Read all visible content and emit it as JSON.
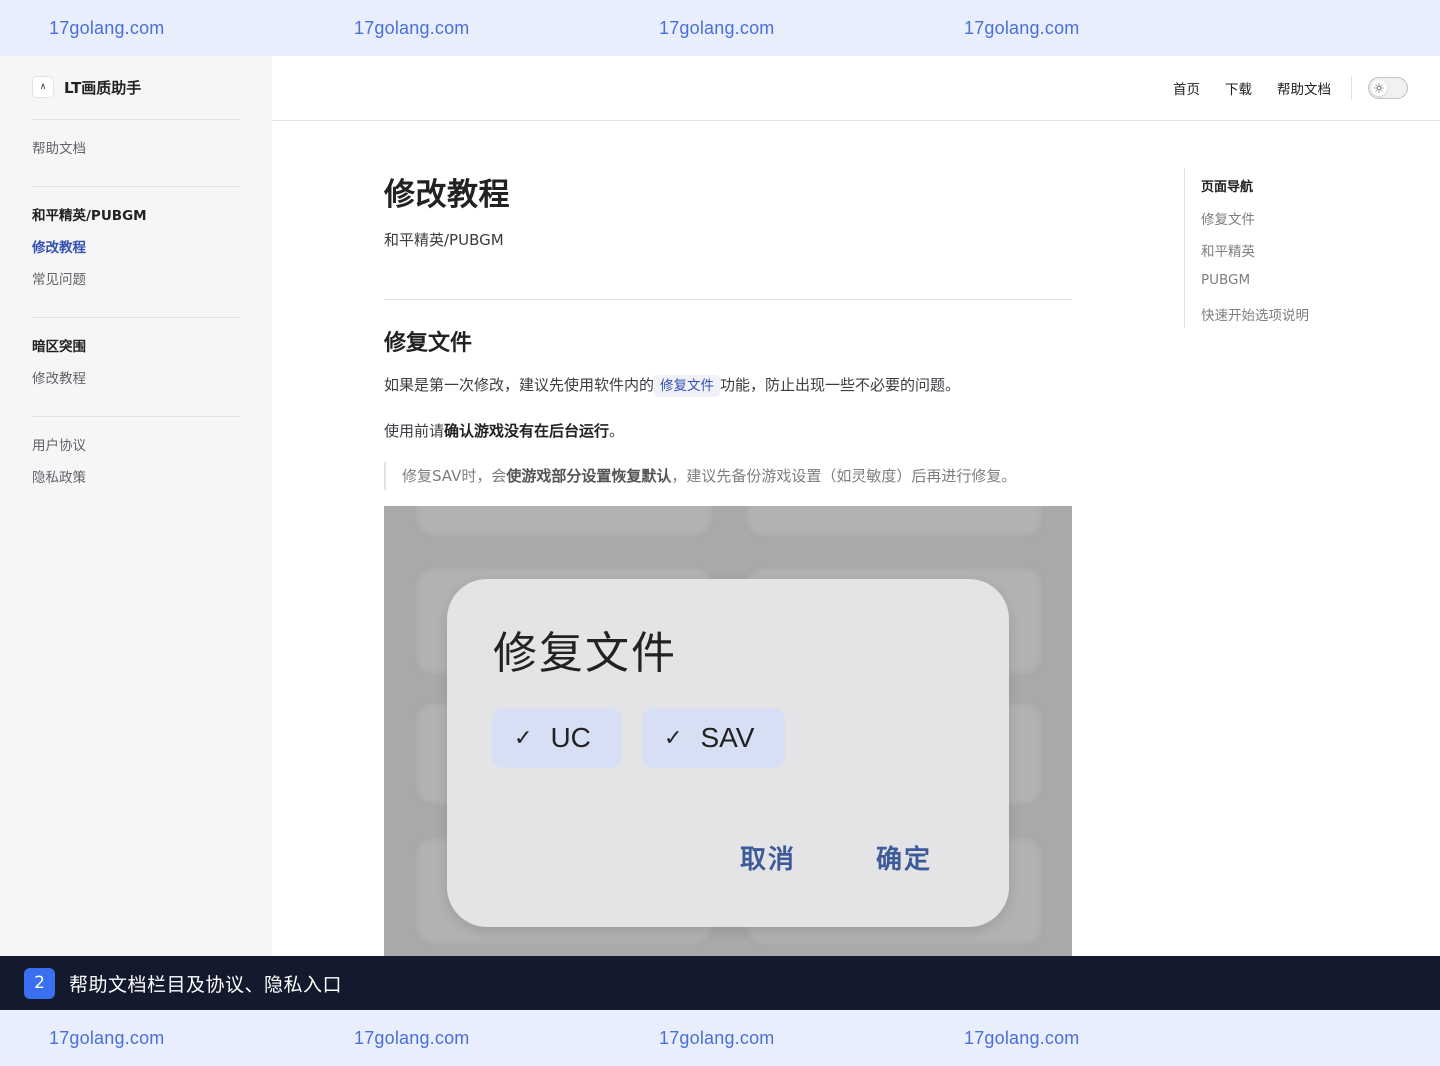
{
  "watermark": {
    "text": "17golang.com"
  },
  "brand": {
    "logo_glyph": "∧",
    "name": "LT画质助手"
  },
  "sidebar": {
    "help_docs": "帮助文档",
    "group1_title": "和平精英/PUBGM",
    "group1_items": [
      "修改教程",
      "常见问题"
    ],
    "group2_title": "暗区突围",
    "group2_items": [
      "修改教程"
    ],
    "footer_items": [
      "用户协议",
      "隐私政策"
    ]
  },
  "header": {
    "nav": [
      "首页",
      "下载",
      "帮助文档"
    ],
    "theme_icon": "sun-icon"
  },
  "main": {
    "title": "修改教程",
    "subtitle": "和平精英/PUBGM",
    "section_title": "修复文件",
    "para1_before": "如果是第一次修改，建议先使用软件内的",
    "para1_code": "修复文件",
    "para1_after": "功能，防止出现一些不必要的问题。",
    "para2_before": "使用前请",
    "para2_bold": "确认游戏没有在后台运行",
    "para2_after": "。",
    "quote_before": "修复SAV时，会",
    "quote_bold": "使游戏部分设置恢复默认",
    "quote_after": "，建议先备份游戏设置（如灵敏度）后再进行修复。"
  },
  "dialog": {
    "title": "修复文件",
    "options": [
      "UC",
      "SAV"
    ],
    "check_glyph": "✓",
    "cancel": "取消",
    "confirm": "确定"
  },
  "aside": {
    "title": "页面导航",
    "links": [
      "修复文件",
      "和平精英",
      "PUBGM",
      "快速开始选项说明"
    ]
  },
  "caption": {
    "number": "2",
    "text": "帮助文档栏目及协议、隐私入口"
  },
  "colors": {
    "accent": "#3451b2",
    "watermark": "#4a6fd8",
    "caption_bg": "#131a2e",
    "badge": "#3a6ff2"
  }
}
